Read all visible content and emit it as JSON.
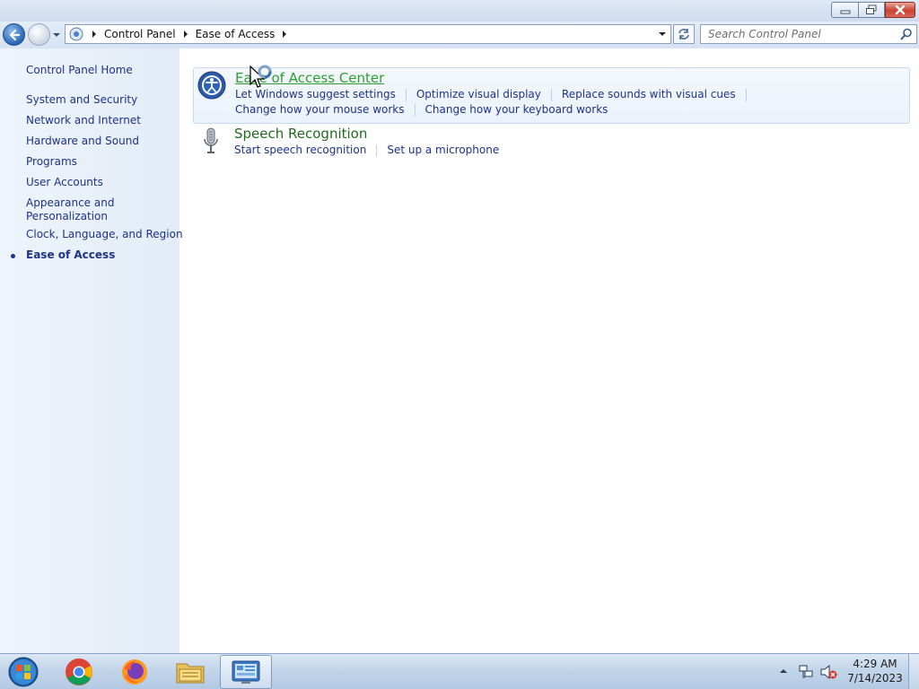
{
  "window": {
    "breadcrumb": [
      "Control Panel",
      "Ease of Access"
    ],
    "search_placeholder": "Search Control Panel"
  },
  "sidebar": {
    "home": "Control Panel Home",
    "items": [
      {
        "label": "System and Security"
      },
      {
        "label": "Network and Internet"
      },
      {
        "label": "Hardware and Sound"
      },
      {
        "label": "Programs"
      },
      {
        "label": "User Accounts"
      },
      {
        "label": "Appearance and"
      },
      {
        "label": "Personalization"
      },
      {
        "label": "Clock, Language, and Region"
      },
      {
        "label": "Ease of Access"
      }
    ],
    "current": "Ease of Access"
  },
  "categories": [
    {
      "title": "Ease of Access Center",
      "icon": "ease-of-access-icon",
      "links_row1": [
        "Let Windows suggest settings",
        "Optimize visual display",
        "Replace sounds with visual cues"
      ],
      "links_row2": [
        "Change how your mouse works",
        "Change how your keyboard works"
      ]
    },
    {
      "title": "Speech Recognition",
      "icon": "microphone-icon",
      "links_row1": [
        "Start speech recognition",
        "Set up a microphone"
      ]
    }
  ],
  "taskbar": {
    "apps": [
      "chrome-icon",
      "firefox-icon",
      "file-explorer-icon",
      "control-panel-icon"
    ],
    "active_app": "control-panel-icon",
    "time": "4:29 AM",
    "date": "7/14/2023"
  },
  "colors": {
    "link": "#1e3287",
    "category_title": "#1e6b1e",
    "category_title_hover": "#2e9e2e",
    "sidebar_bg": "#e8f0fa",
    "close_button": "#c9402f"
  }
}
